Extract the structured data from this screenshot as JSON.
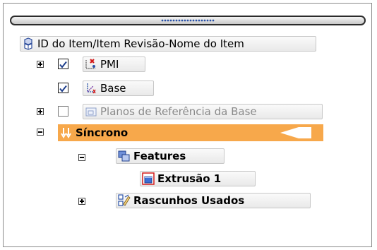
{
  "tree": {
    "root_label": "ID do Item/Item Revisão-Nome do Item",
    "items": [
      {
        "label": "PMI",
        "checked": true,
        "expander": "+"
      },
      {
        "label": "Base",
        "checked": true
      },
      {
        "label": "Planos de Referência da Base",
        "checked": false,
        "expander": "+"
      },
      {
        "label": "Síncrono",
        "expander": "−"
      },
      {
        "label": "Features",
        "expander": "−"
      },
      {
        "label": "Extrusão 1"
      },
      {
        "label": "Rascunhos Usados",
        "expander": "+"
      }
    ]
  },
  "colors": {
    "selection": "#f7a84b",
    "accent_blue": "#2a52a8"
  },
  "icons": [
    "assembly-icon",
    "pmi-icon",
    "coordinate-system-icon",
    "reference-plane-icon",
    "synchronous-icon",
    "features-icon",
    "extrude-icon",
    "sketch-icon"
  ]
}
